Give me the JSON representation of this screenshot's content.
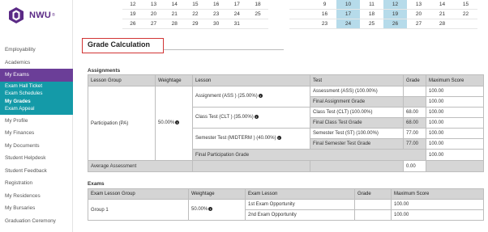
{
  "brand": {
    "name": "NWU",
    "reg": "®"
  },
  "sidebar": {
    "items": [
      {
        "label": "Employability"
      },
      {
        "label": "Academics"
      },
      {
        "label": "My Exams"
      }
    ],
    "sub_items": [
      {
        "label": "Exam Hall Ticket"
      },
      {
        "label": "Exam Schedules"
      },
      {
        "label": "My Grades"
      },
      {
        "label": "Exam Appeal"
      }
    ],
    "items_after": [
      {
        "label": "My Profile"
      },
      {
        "label": "My Finances"
      },
      {
        "label": "My Documents"
      },
      {
        "label": "Student Helpdesk"
      },
      {
        "label": "Student Feedback"
      },
      {
        "label": "Registration"
      },
      {
        "label": "My Residences"
      },
      {
        "label": "My Bursaries"
      },
      {
        "label": "Graduation Ceremony"
      }
    ]
  },
  "calendar_left": [
    [
      "12",
      "13",
      "14",
      "15",
      "16",
      "17",
      "18"
    ],
    [
      "19",
      "20",
      "21",
      "22",
      "23",
      "24",
      "25"
    ],
    [
      "26",
      "27",
      "28",
      "29",
      "30",
      "31",
      ""
    ]
  ],
  "calendar_right": [
    [
      "",
      "9",
      "10",
      "11",
      "12",
      "13",
      "14",
      "15"
    ],
    [
      "",
      "16",
      "17",
      "18",
      "19",
      "20",
      "21",
      "22"
    ],
    [
      "",
      "23",
      "24",
      "25",
      "26",
      "27",
      "28",
      ""
    ]
  ],
  "page_title": "Grade Calculation",
  "assignments": {
    "label": "Assignments",
    "headers": [
      "Lesson Group",
      "Weightage",
      "Lesson",
      "Test",
      "Grade",
      "Maximum Score"
    ],
    "group": "Participation (PA)",
    "weightage": "50.00%",
    "lessons": [
      {
        "name": "Assignment (ASS ) (25.00%)",
        "test": "Assessment (ASS) (100.00%)",
        "grade": "",
        "max": "100.00",
        "final_label": "Final Assignment Grade",
        "final_grade": "",
        "final_max": "100.00"
      },
      {
        "name": "Class Test (CLT ) (35.00%)",
        "test": "Class Test (CLT) (100.00%)",
        "grade": "68.00",
        "max": "100.00",
        "final_label": "Final Class Test Grade",
        "final_grade": "68.00",
        "final_max": "100.00"
      },
      {
        "name": "Semester Test (MIDTERM ) (40.00%)",
        "test": "Semester Test (ST) (100.00%)",
        "grade": "77.00",
        "max": "100.00",
        "final_label": "Final Semester Test Grade",
        "final_grade": "77.00",
        "final_max": "100.00"
      }
    ],
    "final_participation_label": "Final Participation Grade",
    "final_participation_max": "100.00",
    "average_label": "Average Assessment",
    "average_grade": "0.00"
  },
  "exams": {
    "label": "Exams",
    "headers": [
      "Exam Lesson Group",
      "Weightage",
      "Exam Lesson",
      "Grade",
      "Maximum Score"
    ],
    "group": "Group 1",
    "weightage": "50.00%",
    "rows": [
      {
        "lesson": "1st Exam Opportunity",
        "grade": "",
        "max": "100.00"
      },
      {
        "lesson": "2nd Exam Opportunity",
        "grade": "",
        "max": "100.00"
      }
    ]
  },
  "icons": {
    "info": "info-icon",
    "logo": "nwu-logo-icon"
  },
  "colors": {
    "brand_purple": "#6b3e98",
    "teal": "#149aa8",
    "highlight": "#b6dbea",
    "title_border": "#d23434"
  }
}
